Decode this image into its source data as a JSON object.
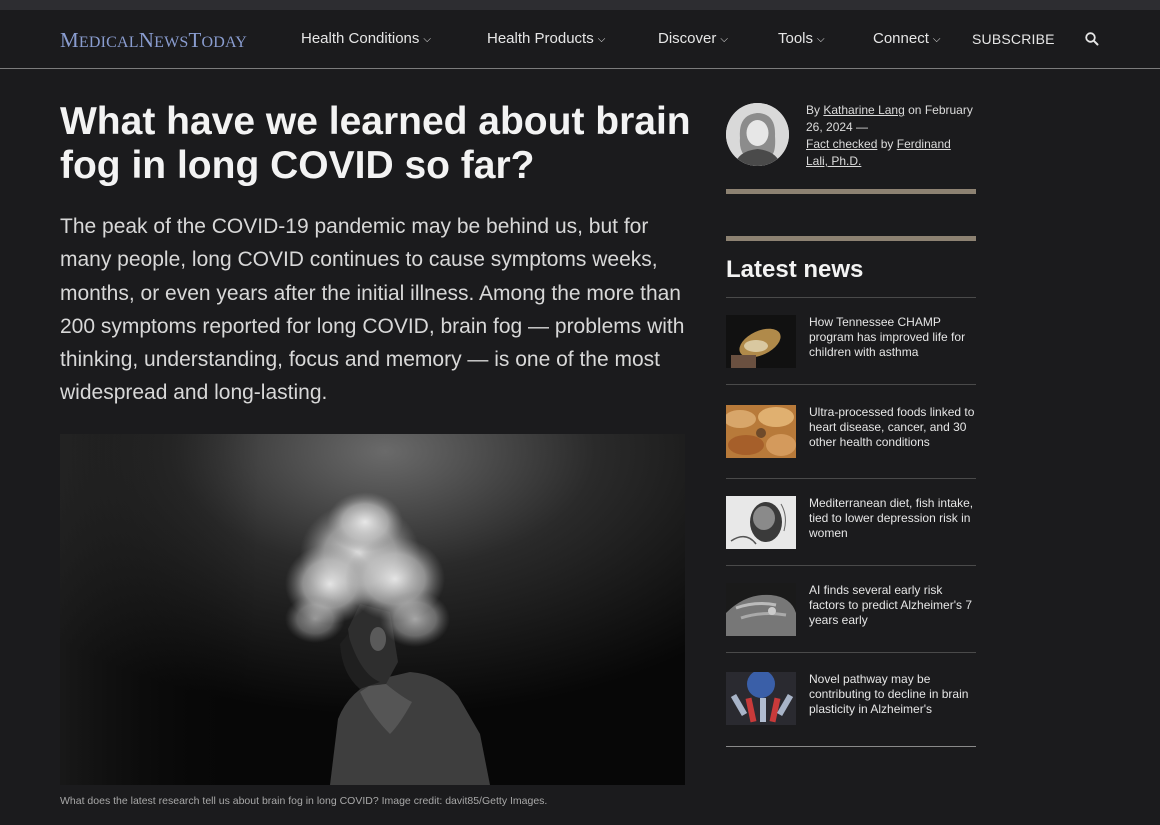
{
  "nav": {
    "logo": {
      "m1": "M",
      "m2": "EDICAL",
      "n1": "N",
      "n2": "EWS",
      "t1": "T",
      "t2": "ODAY"
    },
    "items": [
      {
        "label": "Health Conditions"
      },
      {
        "label": "Health Products"
      },
      {
        "label": "Discover"
      },
      {
        "label": "Tools"
      },
      {
        "label": "Connect"
      }
    ],
    "subscribe": "SUBSCRIBE",
    "search_icon": "search-icon",
    "chevron": "⌵"
  },
  "article": {
    "title": "What have we learned about brain fog in long COVID so far?",
    "lede": "The peak of the COVID-19 pandemic may be behind us, but for many people, long COVID continues to cause symptoms weeks, months, or even years after the initial illness. Among the more than 200 symptoms reported for long COVID, brain fog — problems with thinking, understanding, focus and memory — is one of the most widespread and long-lasting.",
    "image_caption": "What does the latest research tell us about brain fog in long COVID? Image credit: davit85/Getty Images."
  },
  "byline": {
    "by": "By",
    "author": "Katharine Lang",
    "on": "on",
    "date": "February 26, 2024 —",
    "fact_checked": "Fact checked",
    "by2": "by",
    "checker": "Ferdinand Lali, Ph.D."
  },
  "latest": {
    "title": "Latest news",
    "items": [
      {
        "text": "How Tennessee CHAMP program has improved life for children with asthma"
      },
      {
        "text": "Ultra-processed foods linked to heart disease, cancer, and 30 other health conditions"
      },
      {
        "text": "Mediterranean diet, fish intake, tied to lower depression risk in women"
      },
      {
        "text": "AI finds several early risk factors to predict Alzheimer's 7 years early"
      },
      {
        "text": "Novel pathway may be contributing to decline in brain plasticity in Alzheimer's"
      }
    ]
  },
  "colors": {
    "background": "#1b1b1d",
    "logo": "#8a9dd0",
    "accent_bar": "#8d8272"
  }
}
